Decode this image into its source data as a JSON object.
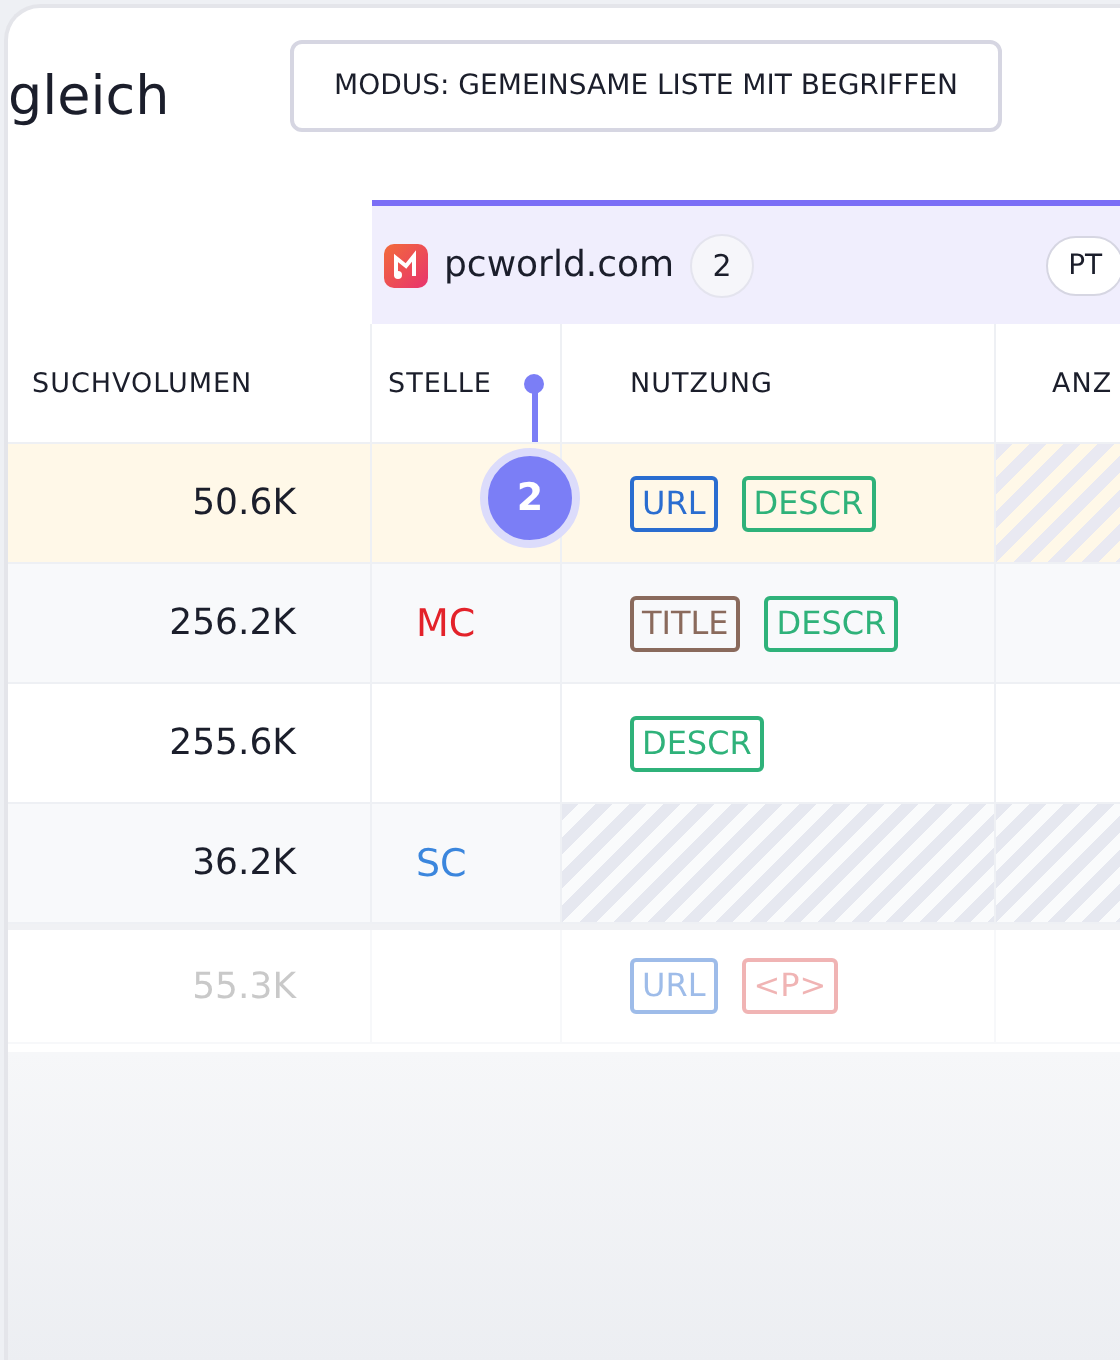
{
  "header": {
    "title": "gleich",
    "mode_button": "MODUS: GEMEINSAME LISTE MIT BEGRIFFEN"
  },
  "domain": {
    "name": "pcworld.com",
    "count": "2",
    "pill": "PT"
  },
  "columns": [
    "SUCHVOLUMEN",
    "STELLE",
    "NUTZUNG",
    "ANZ"
  ],
  "rows": [
    {
      "volume": "50.6K",
      "highlighted": true,
      "faded": false,
      "marker": "2",
      "usage_hatched": false,
      "column_4_hatched": true,
      "tags": [
        {
          "text": "URL",
          "kind": "url"
        },
        {
          "text": "DESCR",
          "kind": "descr"
        }
      ]
    },
    {
      "volume": "256.2K",
      "highlighted": false,
      "faded": false,
      "position": {
        "text": "MC",
        "kind": "mc"
      },
      "usage_hatched": false,
      "column_4_hatched": false,
      "tags": [
        {
          "text": "TITLE",
          "kind": "title"
        },
        {
          "text": "DESCR",
          "kind": "descr"
        }
      ]
    },
    {
      "volume": "255.6K",
      "highlighted": false,
      "faded": false,
      "usage_hatched": false,
      "column_4_hatched": false,
      "tags": [
        {
          "text": "DESCR",
          "kind": "descr"
        }
      ]
    },
    {
      "volume": "36.2K",
      "highlighted": false,
      "faded": false,
      "position": {
        "text": "SC",
        "kind": "sc"
      },
      "usage_hatched": true,
      "column_4_hatched": true,
      "tags": []
    },
    {
      "volume": "55.3K",
      "highlighted": false,
      "faded": true,
      "usage_hatched": false,
      "column_4_hatched": false,
      "tags": [
        {
          "text": "URL",
          "kind": "url"
        },
        {
          "text": "<P>",
          "kind": "p"
        }
      ]
    }
  ]
}
